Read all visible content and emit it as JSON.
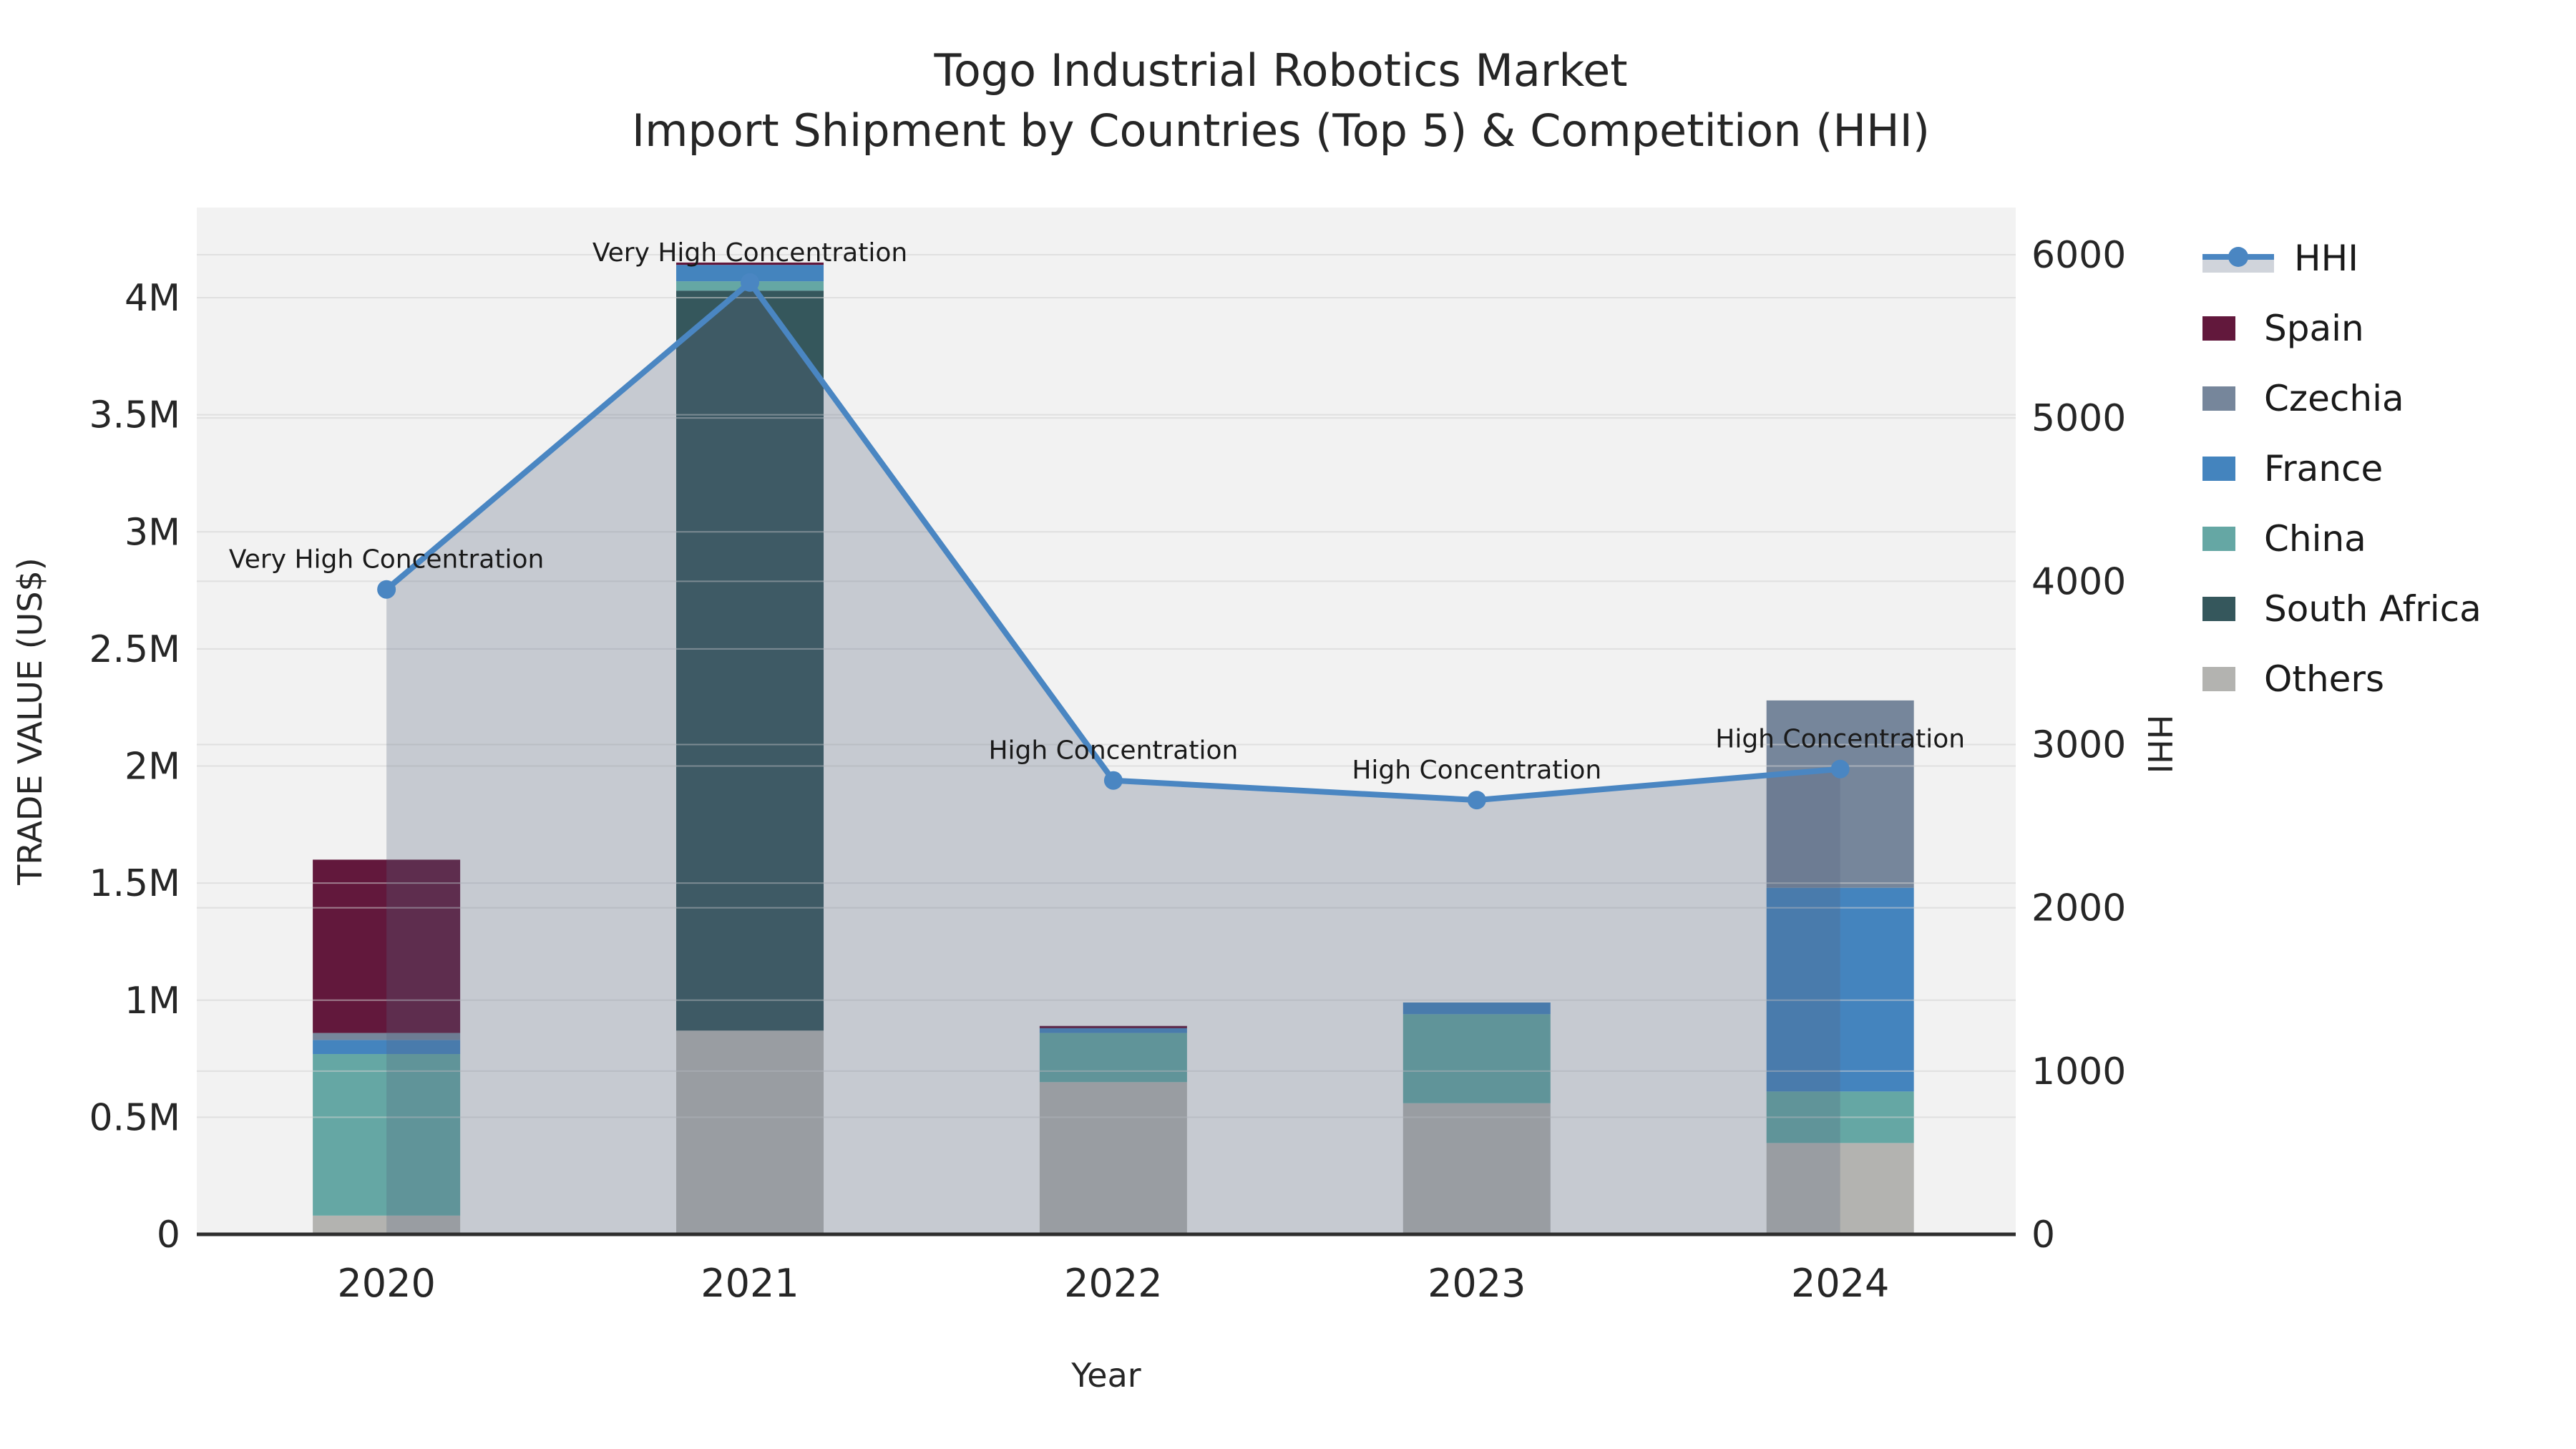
{
  "title": {
    "line1": "Togo Industrial Robotics Market",
    "line2": "Import Shipment by Countries (Top 5) & Competition (HHI)"
  },
  "axes": {
    "x_label": "Year",
    "y_left_label": "TRADE VALUE (US$)",
    "y_right_label": "HHI",
    "y_left_ticks": [
      "0",
      "0.5M",
      "1M",
      "1.5M",
      "2M",
      "2.5M",
      "3M",
      "3.5M",
      "4M"
    ],
    "y_right_ticks": [
      "0",
      "1000",
      "2000",
      "3000",
      "4000",
      "5000",
      "6000"
    ]
  },
  "chart_data": {
    "type": "combo: stacked bar (trade value, left axis) + line with area fill (HHI, right axis)",
    "categories": [
      "2020",
      "2021",
      "2022",
      "2023",
      "2024"
    ],
    "bar_series_bottom_to_top": [
      {
        "name": "Others",
        "color": "#b3b3b0",
        "values": [
          80000,
          870000,
          650000,
          560000,
          390000
        ]
      },
      {
        "name": "South Africa",
        "color": "#35575c",
        "values": [
          0,
          3160000,
          0,
          0,
          0
        ]
      },
      {
        "name": "China",
        "color": "#65a7a4",
        "values": [
          690000,
          40000,
          210000,
          380000,
          220000
        ]
      },
      {
        "name": "France",
        "color": "#4484be",
        "values": [
          60000,
          70000,
          20000,
          50000,
          870000
        ]
      },
      {
        "name": "Czechia",
        "color": "#76869b",
        "values": [
          30000,
          0,
          0,
          0,
          800000
        ]
      },
      {
        "name": "Spain",
        "color": "#62183c",
        "values": [
          740000,
          10000,
          10000,
          0,
          0
        ]
      }
    ],
    "bar_totals": [
      1600000,
      4150000,
      890000,
      990000,
      2280000
    ],
    "line_series": {
      "name": "HHI",
      "color": "#4a86c2",
      "area_fill": "rgba(87,101,127,0.28)",
      "values": [
        3950,
        5830,
        2780,
        2660,
        2850
      ]
    },
    "annotations": [
      "Very High Concentration",
      "Very High Concentration",
      "High Concentration",
      "High Concentration",
      "High Concentration"
    ],
    "ylim_left": [
      0,
      4400000
    ],
    "ylim_right": [
      0,
      6300
    ],
    "grid": true,
    "plot_background": "#f2f2f2",
    "legend_position": "right",
    "legend_order": [
      "HHI",
      "Spain",
      "Czechia",
      "France",
      "China",
      "South Africa",
      "Others"
    ]
  }
}
